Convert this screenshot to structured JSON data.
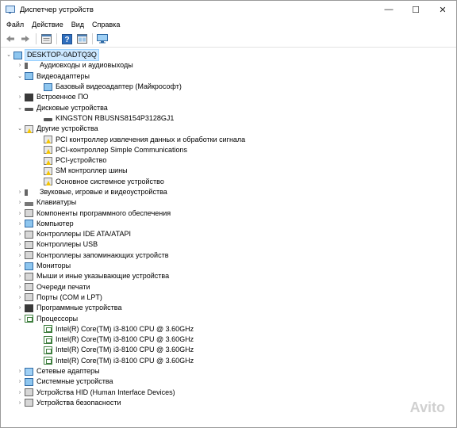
{
  "window": {
    "title": "Диспетчер устройств",
    "minimize": "—",
    "maximize": "☐",
    "close": "✕"
  },
  "menu": [
    "Файл",
    "Действие",
    "Вид",
    "Справка"
  ],
  "toolbar": [
    "back-icon",
    "forward-icon",
    "properties-icon",
    "help-icon",
    "view-icon",
    "monitor-icon"
  ],
  "tree": {
    "root": "DESKTOP-0ADTQ3Q",
    "items": [
      {
        "label": "Аудиовходы и аудиовыходы",
        "expanded": false,
        "icon": "speaker-icon"
      },
      {
        "label": "Видеоадаптеры",
        "expanded": true,
        "icon": "display-adapter-icon",
        "children": [
          {
            "label": "Базовый видеоадаптер (Майкрософт)",
            "icon": "display-adapter-icon"
          }
        ]
      },
      {
        "label": "Встроенное ПО",
        "expanded": false,
        "icon": "firmware-icon"
      },
      {
        "label": "Дисковые устройства",
        "expanded": true,
        "icon": "disk-icon",
        "children": [
          {
            "label": "KINGSTON RBUSNS8154P3128GJ1",
            "icon": "disk-icon"
          }
        ]
      },
      {
        "label": "Другие устройства",
        "expanded": true,
        "icon": "unknown-device-icon",
        "children": [
          {
            "label": "PCI контроллер извлечения данных и обработки сигнала",
            "icon": "warning-device-icon"
          },
          {
            "label": "PCI-контроллер Simple Communications",
            "icon": "warning-device-icon"
          },
          {
            "label": "PCI-устройство",
            "icon": "warning-device-icon"
          },
          {
            "label": "SM контроллер шины",
            "icon": "warning-device-icon"
          },
          {
            "label": "Основное системное устройство",
            "icon": "warning-device-icon"
          }
        ]
      },
      {
        "label": "Звуковые, игровые и видеоустройства",
        "expanded": false,
        "icon": "speaker-icon"
      },
      {
        "label": "Клавиатуры",
        "expanded": false,
        "icon": "keyboard-icon"
      },
      {
        "label": "Компоненты программного обеспечения",
        "expanded": false,
        "icon": "component-icon"
      },
      {
        "label": "Компьютер",
        "expanded": false,
        "icon": "computer-icon"
      },
      {
        "label": "Контроллеры IDE ATA/ATAPI",
        "expanded": false,
        "icon": "ide-controller-icon"
      },
      {
        "label": "Контроллеры USB",
        "expanded": false,
        "icon": "usb-icon"
      },
      {
        "label": "Контроллеры запоминающих устройств",
        "expanded": false,
        "icon": "storage-controller-icon"
      },
      {
        "label": "Мониторы",
        "expanded": false,
        "icon": "monitor-icon"
      },
      {
        "label": "Мыши и иные указывающие устройства",
        "expanded": false,
        "icon": "mouse-icon"
      },
      {
        "label": "Очереди печати",
        "expanded": false,
        "icon": "printer-icon"
      },
      {
        "label": "Порты (COM и LPT)",
        "expanded": false,
        "icon": "port-icon"
      },
      {
        "label": "Программные устройства",
        "expanded": false,
        "icon": "software-device-icon"
      },
      {
        "label": "Процессоры",
        "expanded": true,
        "icon": "cpu-icon",
        "children": [
          {
            "label": "Intel(R) Core(TM) i3-8100 CPU @ 3.60GHz",
            "icon": "cpu-icon"
          },
          {
            "label": "Intel(R) Core(TM) i3-8100 CPU @ 3.60GHz",
            "icon": "cpu-icon"
          },
          {
            "label": "Intel(R) Core(TM) i3-8100 CPU @ 3.60GHz",
            "icon": "cpu-icon"
          },
          {
            "label": "Intel(R) Core(TM) i3-8100 CPU @ 3.60GHz",
            "icon": "cpu-icon"
          }
        ]
      },
      {
        "label": "Сетевые адаптеры",
        "expanded": false,
        "icon": "network-icon"
      },
      {
        "label": "Системные устройства",
        "expanded": false,
        "icon": "system-device-icon"
      },
      {
        "label": "Устройства HID (Human Interface Devices)",
        "expanded": false,
        "icon": "hid-icon"
      },
      {
        "label": "Устройства безопасности",
        "expanded": false,
        "icon": "security-device-icon"
      }
    ]
  },
  "watermark": "Avito"
}
